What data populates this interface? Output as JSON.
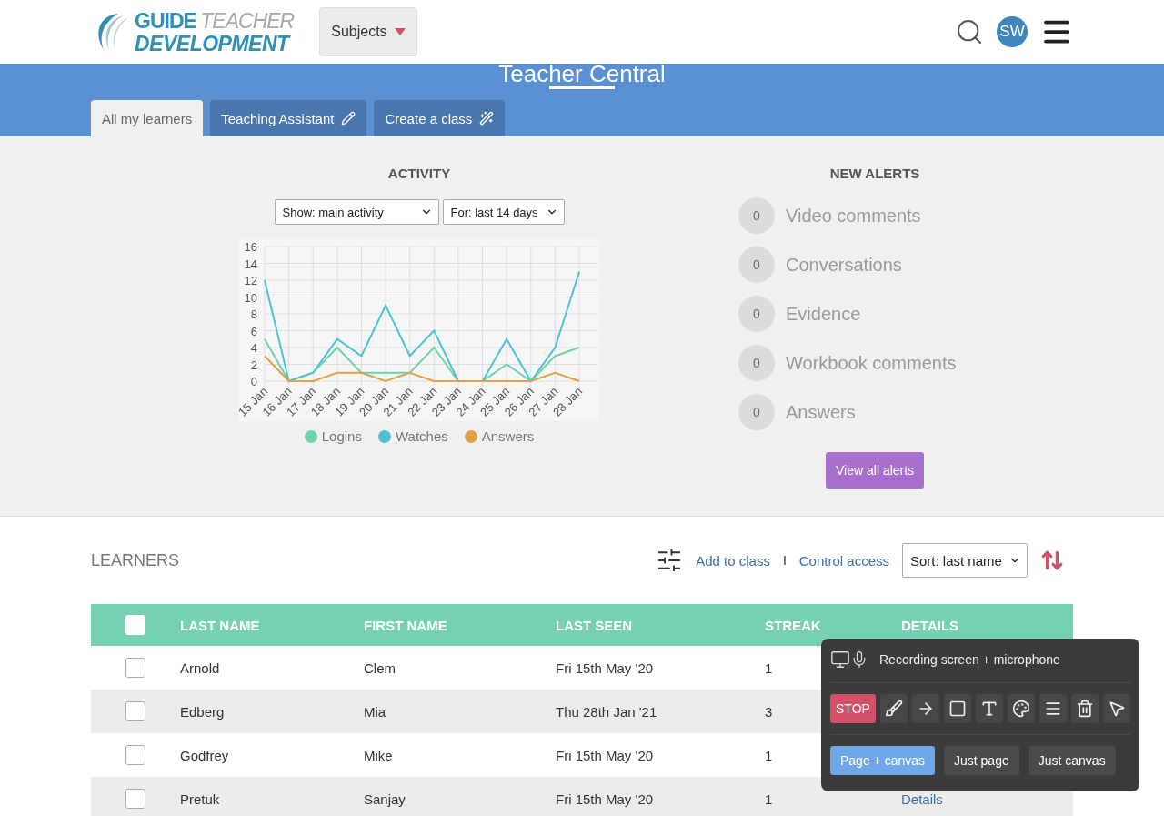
{
  "header": {
    "logo": {
      "word1": "GUIDE",
      "word2": "TEACHER",
      "word3": "DEVELOPMENT"
    },
    "subjects_button": "Subjects",
    "avatar": "SW"
  },
  "banner": {
    "title": "Teacher Central",
    "tabs": [
      {
        "label": "All my learners",
        "selected": true,
        "kind": "plain"
      },
      {
        "label": "Teaching Assistant",
        "selected": false,
        "kind": "pencil"
      },
      {
        "label": "Create a class",
        "selected": false,
        "kind": "wand"
      }
    ]
  },
  "activity": {
    "title": "ACTIVITY",
    "show_select": "Show: main activity",
    "period_select": "For: last 14 days",
    "chart_data": {
      "type": "line",
      "categories": [
        "15 Jan",
        "16 Jan",
        "17 Jan",
        "18 Jan",
        "19 Jan",
        "20 Jan",
        "21 Jan",
        "22 Jan",
        "23 Jan",
        "24 Jan",
        "25 Jan",
        "26 Jan",
        "27 Jan",
        "28 Jan"
      ],
      "ylim": [
        0,
        16
      ],
      "grid": true,
      "yticks": [
        0,
        2,
        4,
        6,
        8,
        10,
        12,
        14,
        16
      ],
      "series": [
        {
          "name": "Logins",
          "color": "#6fd3a8",
          "values": [
            5,
            0,
            1,
            4,
            1,
            1,
            1,
            4,
            0,
            0,
            2,
            0,
            3,
            4
          ]
        },
        {
          "name": "Watches",
          "color": "#4cc3d3",
          "values": [
            12,
            0,
            1,
            5,
            3,
            9,
            3,
            6,
            0,
            0,
            5,
            0,
            4,
            13
          ]
        },
        {
          "name": "Answers",
          "color": "#e2a04a",
          "values": [
            3,
            0,
            0,
            1,
            1,
            0,
            1,
            0,
            0,
            0,
            0,
            0,
            1,
            0
          ]
        }
      ]
    }
  },
  "alerts": {
    "title": "NEW ALERTS",
    "items": [
      {
        "count": "0",
        "label": "Video comments"
      },
      {
        "count": "0",
        "label": "Conversations"
      },
      {
        "count": "0",
        "label": "Evidence"
      },
      {
        "count": "0",
        "label": "Workbook comments"
      },
      {
        "count": "0",
        "label": "Answers"
      }
    ],
    "button": "View all alerts"
  },
  "learners": {
    "title": "LEARNERS",
    "add_link": "Add to class",
    "separator": "I",
    "control_link": "Control access",
    "sort_select": "Sort: last name",
    "columns": [
      "LAST NAME",
      "FIRST NAME",
      "LAST SEEN",
      "STREAK",
      "DETAILS"
    ],
    "select_all_checked": false,
    "rows": [
      {
        "checked": false,
        "last_name": "Arnold",
        "first_name": "Clem",
        "last_seen": "Fri 15th May '20",
        "streak": "1"
      },
      {
        "checked": false,
        "last_name": "Edberg",
        "first_name": "Mia",
        "last_seen": "Thu 28th Jan '21",
        "streak": "3"
      },
      {
        "checked": false,
        "last_name": "Godfrey",
        "first_name": "Mike",
        "last_seen": "Fri 15th May '20",
        "streak": "1"
      },
      {
        "checked": false,
        "last_name": "Pretuk",
        "first_name": "Sanjay",
        "last_seen": "Fri 15th May '20",
        "streak": "1",
        "details": "Details"
      }
    ]
  },
  "recorder": {
    "status": "Recording screen + microphone",
    "stop": "STOP",
    "tools": [
      {
        "kind": "brush"
      },
      {
        "kind": "arrow"
      },
      {
        "kind": "rectangle"
      },
      {
        "kind": "text"
      },
      {
        "kind": "palette"
      },
      {
        "kind": "lines"
      },
      {
        "kind": "trash"
      },
      {
        "kind": "pointer"
      }
    ],
    "modes": [
      {
        "label": "Page + canvas",
        "selected": true
      },
      {
        "label": "Just page",
        "selected": false
      },
      {
        "label": "Just canvas",
        "selected": false
      }
    ]
  }
}
